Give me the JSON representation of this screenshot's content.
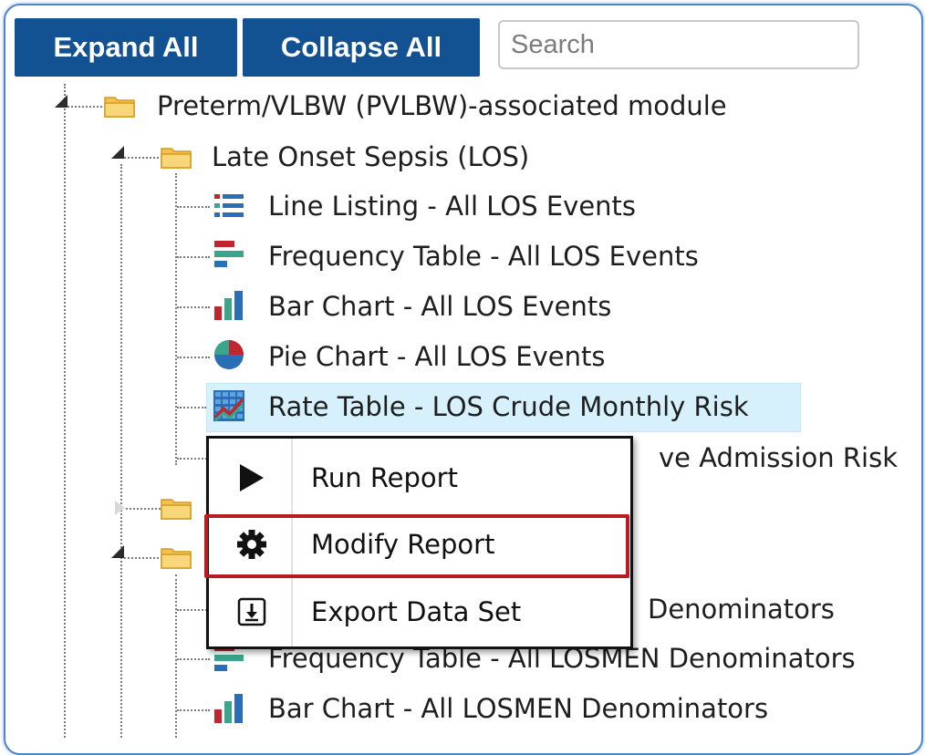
{
  "toolbar": {
    "expand_all_label": "Expand All",
    "collapse_all_label": "Collapse All",
    "search_placeholder": "Search"
  },
  "tree": {
    "module": {
      "label": "Preterm/VLBW (PVLBW)-associated module",
      "expanded": true
    },
    "group_los": {
      "label": "Late Onset Sepsis (LOS)",
      "expanded": true,
      "items": [
        {
          "label": "Line Listing - All LOS Events",
          "icon": "line-listing-icon"
        },
        {
          "label": "Frequency Table - All LOS Events",
          "icon": "frequency-table-icon"
        },
        {
          "label": "Bar Chart - All LOS Events",
          "icon": "bar-chart-icon"
        },
        {
          "label": "Pie Chart - All LOS Events",
          "icon": "pie-chart-icon"
        },
        {
          "label": "Rate Table - LOS Crude Monthly Risk",
          "icon": "rate-table-icon",
          "selected": true
        },
        {
          "label": "ve Admission Risk",
          "icon": "rate-table-icon"
        }
      ]
    },
    "group_collapsed": {
      "label": "",
      "expanded": false
    },
    "group_losmen": {
      "label": "",
      "expanded": true,
      "items": [
        {
          "label": "Denominators",
          "icon": "line-listing-icon"
        },
        {
          "label": "Frequency Table - All LOSMEN Denominators",
          "icon": "frequency-table-icon"
        },
        {
          "label": "Bar Chart - All LOSMEN Denominators",
          "icon": "bar-chart-icon"
        }
      ]
    }
  },
  "context_menu": {
    "items": [
      {
        "label": "Run Report",
        "icon": "play-icon"
      },
      {
        "label": "Modify Report",
        "icon": "gear-icon",
        "highlighted": true
      },
      {
        "label": "Export Data Set",
        "icon": "export-icon"
      }
    ]
  },
  "colors": {
    "button_bg": "#125293",
    "selection_bg": "#d6f1fb",
    "highlight_border": "#b81c22",
    "frame_border": "#4a86c8"
  }
}
